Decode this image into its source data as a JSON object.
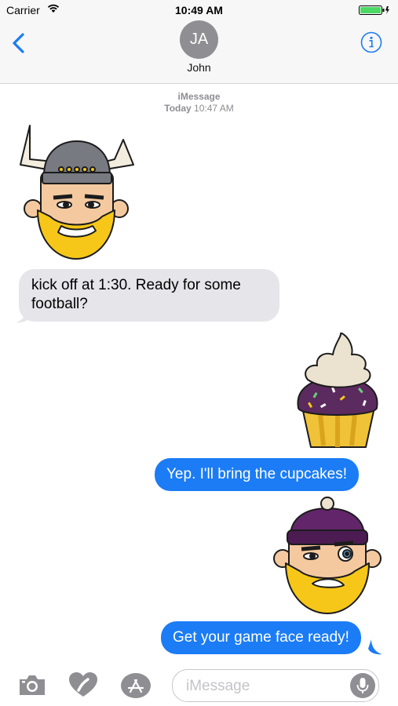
{
  "status_bar": {
    "carrier": "Carrier",
    "time": "10:49 AM"
  },
  "nav": {
    "back_icon": "chevron-left-icon",
    "avatar_initials": "JA",
    "contact_name": "John",
    "info_icon": "info-icon"
  },
  "thread": {
    "service": "iMessage",
    "timestamp_day": "Today",
    "timestamp_time": "10:47 AM"
  },
  "messages": [
    {
      "type": "sticker",
      "from": "them",
      "sticker": "viking-sticker"
    },
    {
      "type": "text",
      "from": "them",
      "text": "kick off at 1:30. Ready for some football?"
    },
    {
      "type": "sticker",
      "from": "me",
      "sticker": "cupcake-sticker"
    },
    {
      "type": "text",
      "from": "me",
      "text": "Yep. I'll bring the cupcakes!"
    },
    {
      "type": "sticker",
      "from": "me",
      "sticker": "viking-beanie-sticker"
    },
    {
      "type": "text",
      "from": "me",
      "text": "Get your game face ready!"
    }
  ],
  "input": {
    "placeholder": "iMessage",
    "tools": [
      "camera-icon",
      "digital-touch-icon",
      "app-store-icon"
    ],
    "mic_icon": "microphone-icon"
  },
  "colors": {
    "accent": "#1b7cf5",
    "incoming_bubble": "#e5e5ea",
    "battery": "#4cd964"
  }
}
